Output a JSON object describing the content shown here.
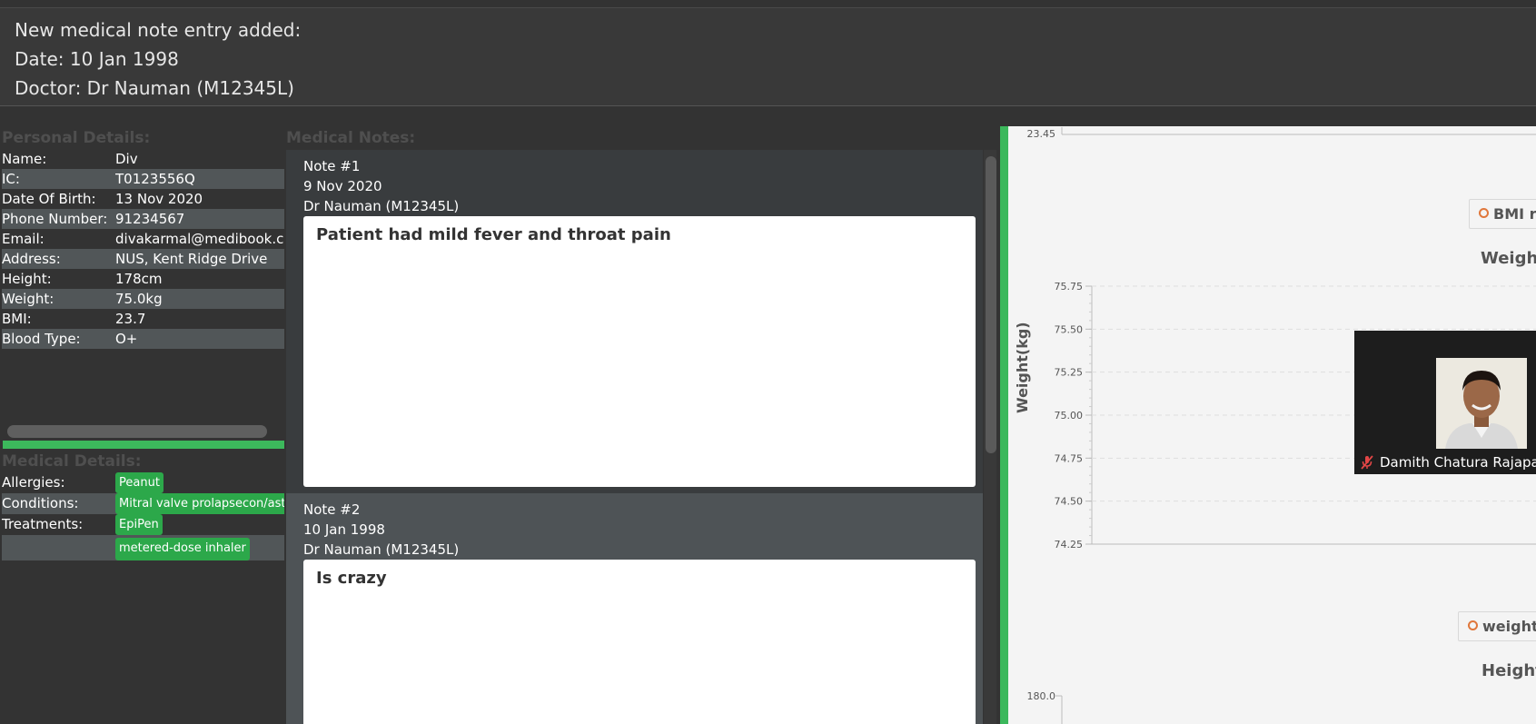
{
  "result": {
    "lines": [
      "New medical note entry added:",
      "Date: 10 Jan 1998",
      "Doctor: Dr Nauman (M12345L)"
    ]
  },
  "personal": {
    "title": "Personal Details:",
    "rows": [
      {
        "key": "Name:",
        "value": "Div"
      },
      {
        "key": "IC:",
        "value": "T0123556Q"
      },
      {
        "key": "Date Of Birth:",
        "value": "13 Nov 2020"
      },
      {
        "key": "Phone Number:",
        "value": "91234567"
      },
      {
        "key": "Email:",
        "value": "divakarmal@medibook.co"
      },
      {
        "key": "Address:",
        "value": "NUS, Kent Ridge Drive"
      },
      {
        "key": "Height:",
        "value": "178cm"
      },
      {
        "key": "Weight:",
        "value": "75.0kg"
      },
      {
        "key": "BMI:",
        "value": "23.7"
      },
      {
        "key": "Blood Type:",
        "value": "O+"
      }
    ]
  },
  "medical": {
    "title": "Medical Details:",
    "allergies_label": "Allergies:",
    "allergies": [
      "Peanut"
    ],
    "conditions_label": "Conditions:",
    "conditions": [
      "Mitral valve prolapsecon/asth"
    ],
    "treatments_label": "Treatments:",
    "treatments": [
      "EpiPen",
      "metered-dose inhaler"
    ]
  },
  "notes": {
    "title": "Medical Notes:",
    "items": [
      {
        "number": "Note #1",
        "date": "9 Nov 2020",
        "doctor": "Dr Nauman (M12345L)",
        "content": "Patient had mild fever and throat pain"
      },
      {
        "number": "Note #2",
        "date": "10 Jan 1998",
        "doctor": "Dr Nauman (M12345L)",
        "content": "Is crazy"
      }
    ]
  },
  "charts": {
    "bmi_top_tick": "23.45",
    "bmi_legend": "BMI re",
    "weight_title": "Weight",
    "weight_ylabel": "Weight(kg)",
    "weight_legend": "weight",
    "height_title": "Height",
    "height_top_tick": "180.0"
  },
  "chart_data": {
    "type": "line",
    "title": "Weight",
    "ylabel": "Weight(kg)",
    "ylim": [
      74.25,
      75.75
    ],
    "yticks": [
      "75.75",
      "75.50",
      "75.25",
      "75.00",
      "74.75",
      "74.50",
      "74.25"
    ],
    "grid": true
  },
  "video": {
    "name": "Damith Chatura Rajapakse"
  },
  "colors": {
    "accent_green": "#3cb85c",
    "tag_green": "#2ca84a",
    "legend_orange": "#e0773b"
  }
}
